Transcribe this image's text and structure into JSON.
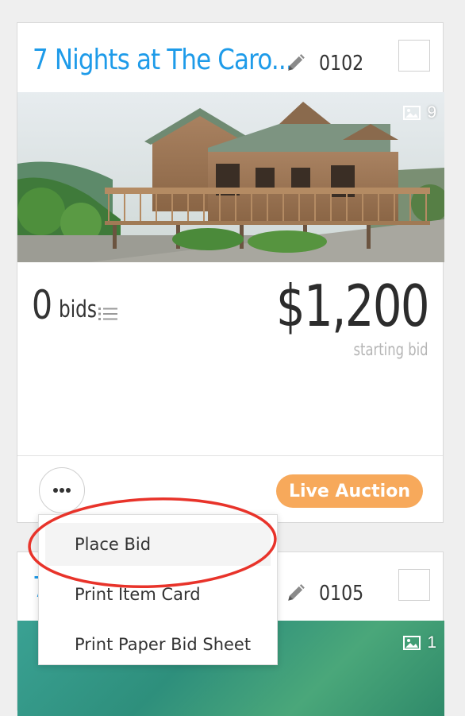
{
  "card1": {
    "title": "7 Nights at The Caro...",
    "item_number": "0102",
    "photo_count": "9",
    "bid_count": "0",
    "bids_label": "bids",
    "price": "$1,200",
    "price_caption": "starting bid",
    "status": "Live Auction"
  },
  "card2": {
    "title": "7",
    "item_number": "0105",
    "photo_count": "1"
  },
  "menu": {
    "items": [
      "Place Bid",
      "Print Item Card",
      "Print Paper Bid Sheet"
    ]
  },
  "colors": {
    "title_blue": "#1e9be9",
    "status_orange": "#f7a95b",
    "annotation_red": "#e8332a"
  },
  "icons": [
    "pencil-icon",
    "image-icon",
    "list-icon",
    "ellipsis-icon"
  ]
}
